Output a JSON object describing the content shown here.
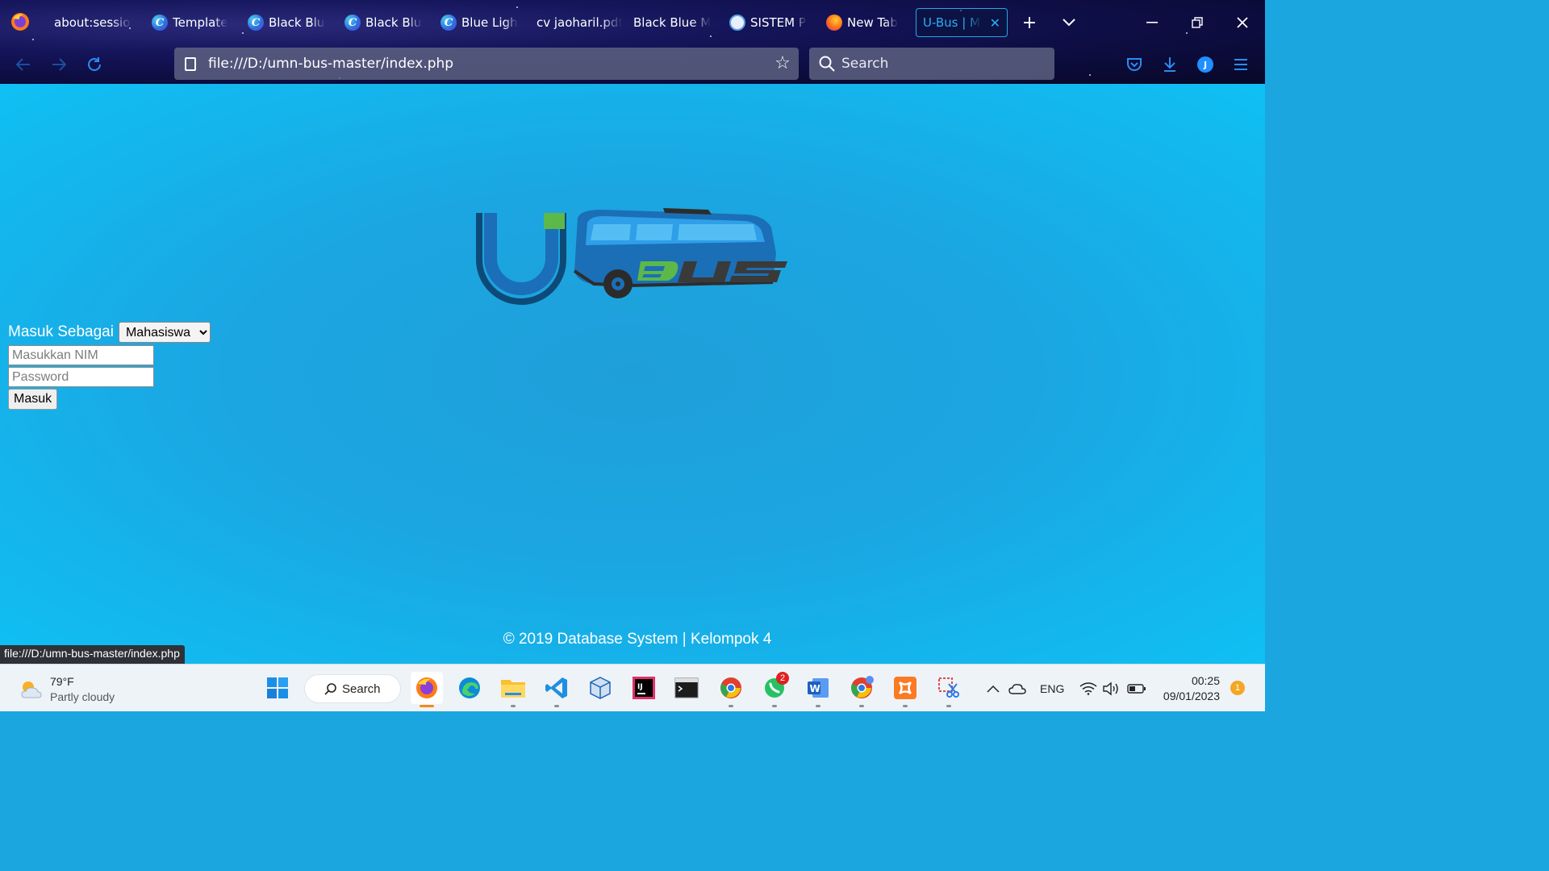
{
  "browser": {
    "tabs": [
      {
        "label": "about:sessionr",
        "icon": "none"
      },
      {
        "label": "Template",
        "icon": "canva-icon"
      },
      {
        "label": "Black Blue",
        "icon": "canva-icon"
      },
      {
        "label": "Black Blue",
        "icon": "canva-icon"
      },
      {
        "label": "Blue Light",
        "icon": "canva-icon"
      },
      {
        "label": "cv jaoharil.pdf",
        "icon": "none"
      },
      {
        "label": "Black Blue Mo",
        "icon": "none"
      },
      {
        "label": "SISTEM PE",
        "icon": "site-icon"
      },
      {
        "label": "New Tab",
        "icon": "firefox-icon"
      },
      {
        "label": "U-Bus | Ma",
        "icon": "none",
        "active": true
      }
    ],
    "url": "file:///D:/umn-bus-master/index.php",
    "search_placeholder": "Search",
    "account_initial": "J",
    "accent": "#2ab0f0"
  },
  "page": {
    "logo_text": "U BUS",
    "login": {
      "as_label": "Masuk Sebagai",
      "role_selected": "Mahasiswa",
      "nim_placeholder": "Masukkan NIM",
      "password_placeholder": "Password",
      "submit_label": "Masuk"
    },
    "footer": "© 2019 Database System | Kelompok 4",
    "status_url": "file:///D:/umn-bus-master/index.php",
    "background": "#1ba6e0"
  },
  "taskbar": {
    "weather": {
      "temp": "79°F",
      "desc": "Partly cloudy"
    },
    "search_label": "Search",
    "apps": [
      "windows-start-icon",
      "firefox-icon",
      "edge-icon",
      "file-explorer-icon",
      "vscode-icon",
      "virtualbox-icon",
      "intellij-icon",
      "terminal-icon",
      "chrome-icon",
      "whatsapp-icon",
      "word-icon",
      "chrome-icon",
      "xampp-icon",
      "snipping-tool-icon"
    ],
    "whatsapp_badge": "2",
    "language": "ENG",
    "time": "00:25",
    "date": "09/01/2023",
    "notification_count": "1"
  }
}
